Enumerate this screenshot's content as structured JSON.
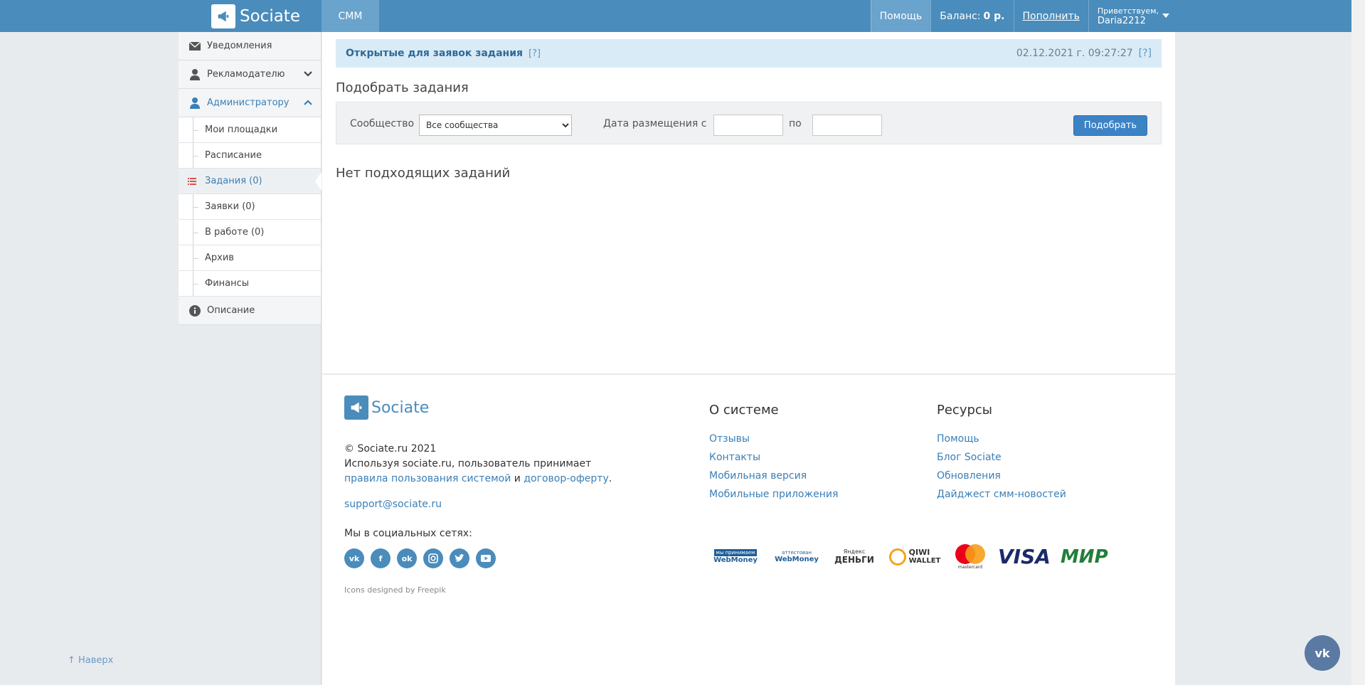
{
  "header": {
    "logo_text": "Sociate",
    "tab_smm": "СММ",
    "help": "Помощь",
    "balance_label": "Баланс:",
    "balance_value": "0 р.",
    "topup": "Пополнить",
    "greeting": "Приветствуем,",
    "username": "Daria2212"
  },
  "sidebar": {
    "notifications": "Уведомления",
    "advertiser": "Рекламодателю",
    "admin": "Администратору",
    "sub": [
      "Мои площадки",
      "Расписание",
      "Задания (0)",
      "Заявки (0)",
      "В работе (0)",
      "Архив",
      "Финансы"
    ],
    "description": "Описание",
    "to_top": "↑ Наверх"
  },
  "main": {
    "notice_title": "Открытые для заявок задания",
    "notice_help": "[?]",
    "notice_date": "02.12.2021 г. 09:27:27",
    "notice_help2": "[?]",
    "select_heading": "Подобрать задания",
    "community_label": "Сообщество",
    "community_value": "Все сообщества",
    "date_label": "Дата размещения с",
    "date_to_label": "по",
    "pick_button": "Подобрать",
    "no_tasks": "Нет подходящих заданий"
  },
  "footer": {
    "logo_text": "Sociate",
    "copyright": "© Sociate.ru 2021",
    "usage_text": "Используя sociate.ru, пользователь принимает",
    "rules_link": "правила пользования системой",
    "and": "и",
    "offer_link": "договор-оферту",
    "period": ".",
    "email": "support@sociate.ru",
    "socials_label": "Мы в социальных сетях:",
    "credit": "Icons designed by Freepik",
    "about_title": "О системе",
    "about_links": [
      "Отзывы",
      "Контакты",
      "Мобильная версия",
      "Мобильные приложения"
    ],
    "resources_title": "Ресурсы",
    "resources_links": [
      "Помощь",
      "Блог Sociate",
      "Обновления",
      "Дайджест смм-новостей"
    ],
    "payments": {
      "wm1_top": "мы принимаем",
      "wm1_bottom": "WebMoney",
      "wm2_top": "аттестован",
      "wm2_bottom": "WebMoney",
      "yandex_top": "Яндекс",
      "yandex_bottom": "ДЕНЬГИ",
      "qiwi_top": "QIWI",
      "qiwi_bottom": "WALLET",
      "mastercard": "mastercard",
      "visa": "VISA",
      "mir": "МИР"
    }
  },
  "vk_float": "vk",
  "colors": {
    "accent": "#4a8cbb",
    "link": "#3a7fb7",
    "button": "#3c83c6"
  }
}
